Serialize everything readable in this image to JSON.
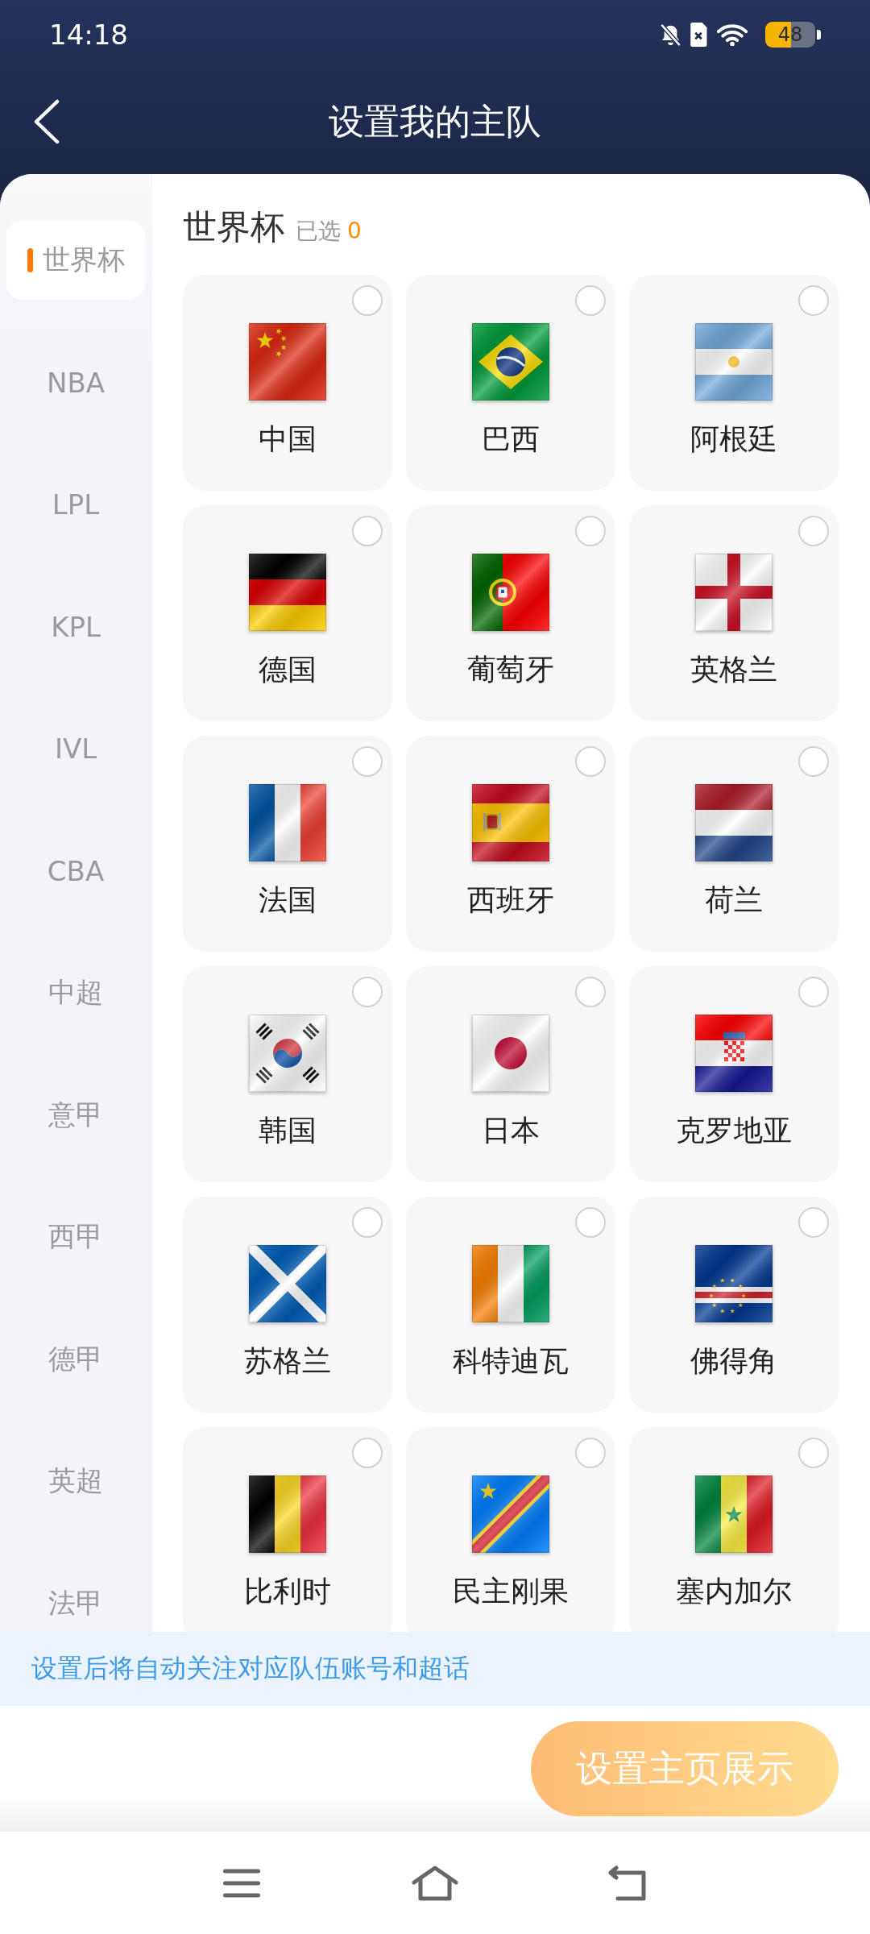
{
  "status_bar": {
    "time": "14:18",
    "battery": "48"
  },
  "header": {
    "title": "设置我的主队"
  },
  "sidebar": {
    "items": [
      {
        "label": "世界杯",
        "selected": true
      },
      {
        "label": "NBA",
        "selected": false
      },
      {
        "label": "LPL",
        "selected": false
      },
      {
        "label": "KPL",
        "selected": false
      },
      {
        "label": "IVL",
        "selected": false
      },
      {
        "label": "CBA",
        "selected": false
      },
      {
        "label": "中超",
        "selected": false
      },
      {
        "label": "意甲",
        "selected": false
      },
      {
        "label": "西甲",
        "selected": false
      },
      {
        "label": "德甲",
        "selected": false
      },
      {
        "label": "英超",
        "selected": false
      },
      {
        "label": "法甲",
        "selected": false
      }
    ]
  },
  "section": {
    "title": "世界杯",
    "selected_label": "已选",
    "selected_count": "0",
    "teams": [
      {
        "name": "中国",
        "kind": "china",
        "selected": false
      },
      {
        "name": "巴西",
        "kind": "brazil",
        "selected": false
      },
      {
        "name": "阿根廷",
        "kind": "argentina",
        "selected": false
      },
      {
        "name": "德国",
        "kind": "germany",
        "selected": false
      },
      {
        "name": "葡萄牙",
        "kind": "portugal",
        "selected": false
      },
      {
        "name": "英格兰",
        "kind": "england",
        "selected": false
      },
      {
        "name": "法国",
        "kind": "france",
        "selected": false
      },
      {
        "name": "西班牙",
        "kind": "spain",
        "selected": false
      },
      {
        "name": "荷兰",
        "kind": "netherlands",
        "selected": false
      },
      {
        "name": "韩国",
        "kind": "korea",
        "selected": false
      },
      {
        "name": "日本",
        "kind": "japan",
        "selected": false
      },
      {
        "name": "克罗地亚",
        "kind": "croatia",
        "selected": false
      },
      {
        "name": "苏格兰",
        "kind": "scotland",
        "selected": false
      },
      {
        "name": "科特迪瓦",
        "kind": "ivorycoast",
        "selected": false
      },
      {
        "name": "佛得角",
        "kind": "capeverde",
        "selected": false
      },
      {
        "name": "比利时",
        "kind": "belgium",
        "selected": false
      },
      {
        "name": "民主刚果",
        "kind": "drcongo",
        "selected": false
      },
      {
        "name": "塞内加尔",
        "kind": "senegal",
        "selected": false
      }
    ]
  },
  "notice": "设置后将自动关注对应队伍账号和超话",
  "action_button": "设置主页展示"
}
